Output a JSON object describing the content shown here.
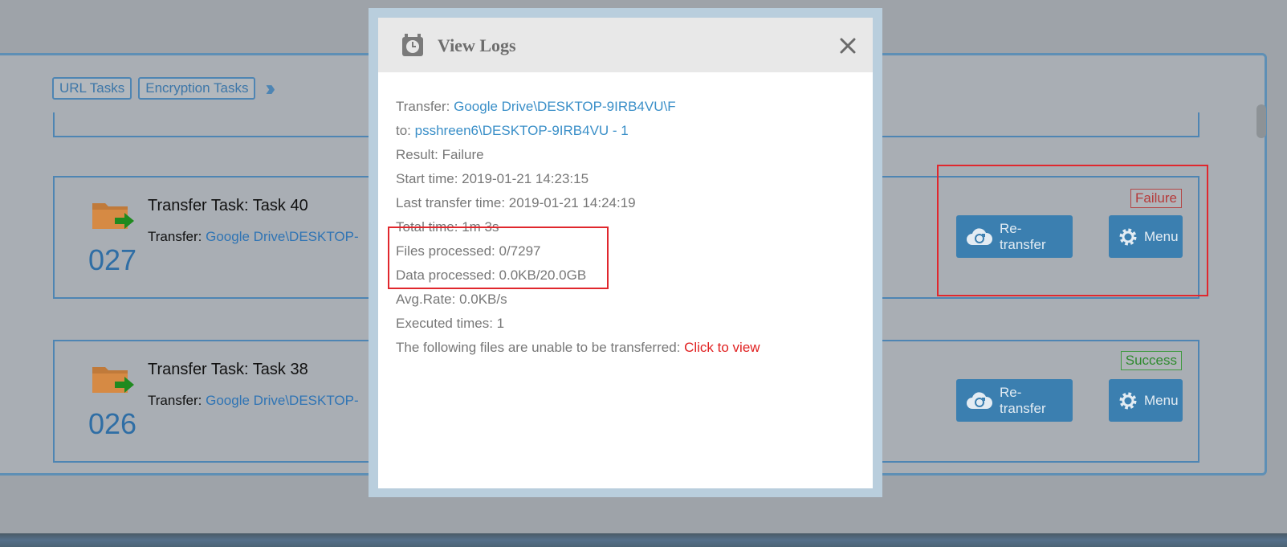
{
  "tabs": [
    "URL Tasks",
    "Encryption Tasks"
  ],
  "tasks": [
    {
      "number": "027",
      "title": "Transfer Task: Task 40",
      "transfer_label": "Transfer:",
      "transfer_link": "Google Drive\\DESKTOP-",
      "status": "Failure",
      "retransfer_label": "Re-transfer",
      "menu_label": "Menu"
    },
    {
      "number": "026",
      "title": "Transfer Task: Task 38",
      "transfer_label": "Transfer:",
      "transfer_link": "Google Drive\\DESKTOP-",
      "status": "Success",
      "retransfer_label": "Re-transfer",
      "menu_label": "Menu"
    }
  ],
  "modal": {
    "title": "View Logs",
    "transfer_label": "Transfer: ",
    "transfer_value": "Google Drive\\DESKTOP-9IRB4VU\\F",
    "to_label": "to: ",
    "to_value": "psshreen6\\DESKTOP-9IRB4VU - 1",
    "result": "Result: Failure",
    "start_time": "Start time: 2019-01-21 14:23:15",
    "last_transfer_time": "Last transfer time: 2019-01-21 14:24:19",
    "total_time": "Total time: 1m 3s",
    "files_processed": "Files processed: 0/7297",
    "data_processed": "Data processed: 0.0KB/20.0GB",
    "avg_rate": "Avg.Rate: 0.0KB/s",
    "executed_times": "Executed times: 1",
    "unable_text": "The following files are unable to be transferred: ",
    "unable_link": "Click to view"
  },
  "colors": {
    "accent": "#3b7fb0",
    "link": "#3a8fc8",
    "failure": "#b53a3a",
    "success": "#2f8a2f",
    "highlight": "#e0272d"
  }
}
